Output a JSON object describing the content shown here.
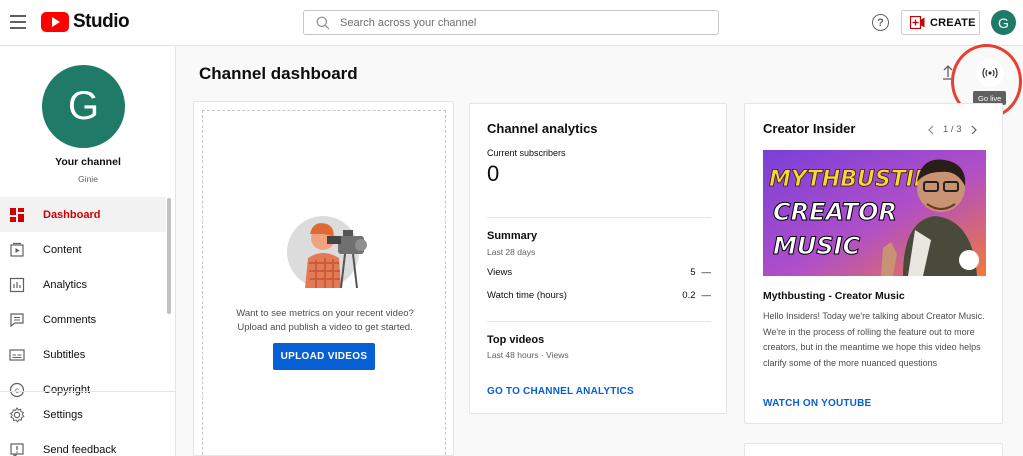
{
  "header": {
    "logo_text": "Studio",
    "search_placeholder": "Search across your channel",
    "help_symbol": "?",
    "create_label": "CREATE",
    "avatar_letter": "G"
  },
  "sidebar": {
    "avatar_letter": "G",
    "your_channel": "Your channel",
    "channel_name": "Ginie",
    "items": [
      {
        "label": "Dashboard",
        "icon": "dashboard-icon",
        "active": true
      },
      {
        "label": "Content",
        "icon": "content-icon"
      },
      {
        "label": "Analytics",
        "icon": "analytics-icon"
      },
      {
        "label": "Comments",
        "icon": "comments-icon"
      },
      {
        "label": "Subtitles",
        "icon": "subtitles-icon"
      },
      {
        "label": "Copyright",
        "icon": "copyright-icon"
      }
    ],
    "bottom_items": [
      {
        "label": "Settings",
        "icon": "gear-icon"
      },
      {
        "label": "Send feedback",
        "icon": "feedback-icon"
      }
    ]
  },
  "main": {
    "title": "Channel dashboard",
    "golive_tooltip": "Go live"
  },
  "video_card": {
    "prompt_line1": "Want to see metrics on your recent video?",
    "prompt_line2": "Upload and publish a video to get started.",
    "upload_button": "UPLOAD VIDEOS"
  },
  "analytics_card": {
    "title": "Channel analytics",
    "subscribers_label": "Current subscribers",
    "subscribers_value": "0",
    "summary_title": "Summary",
    "summary_period": "Last 28 days",
    "rows": [
      {
        "label": "Views",
        "value": "5",
        "trend": "—"
      },
      {
        "label": "Watch time (hours)",
        "value": "0.2",
        "trend": "—"
      }
    ],
    "top_videos_title": "Top videos",
    "top_videos_period": "Last 48 hours · Views",
    "link": "GO TO CHANNEL ANALYTICS"
  },
  "insider_card": {
    "title": "Creator Insider",
    "pager": "1 / 3",
    "thumb_line1": "MYTHBUSTING",
    "thumb_line2": "CREATOR",
    "thumb_line3": "MUSIC",
    "video_title": "Mythbusting - Creator Music",
    "description": "Hello Insiders! Today we're talking about Creator Music. We're in the process of rolling the feature out to more creators, but in the meantime we hope this video helps clarify some of the more nuanced questions",
    "link": "WATCH ON YOUTUBE"
  },
  "colors": {
    "brand_red": "#ff0000",
    "accent_blue": "#065fd4",
    "avatar_green": "#1f7a68",
    "highlight_ring": "#e8402e"
  }
}
